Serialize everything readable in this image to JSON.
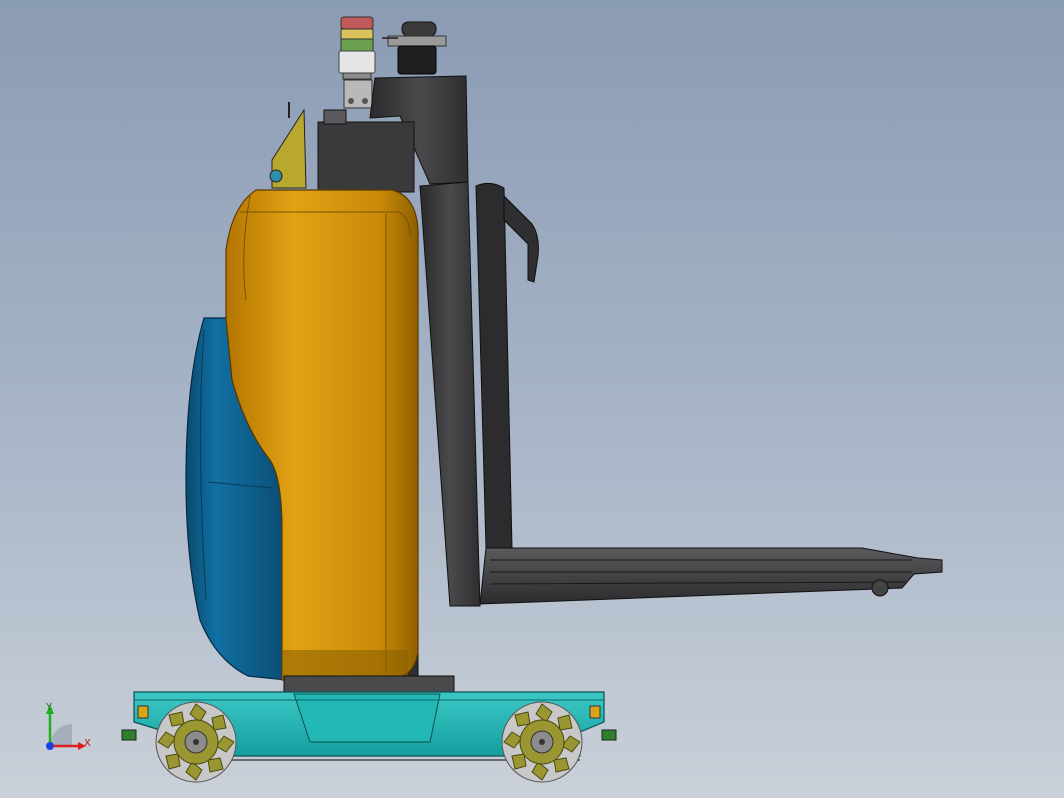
{
  "viewport": {
    "background_top": "#8a9bb4",
    "background_bottom": "#c9d0d8"
  },
  "model": {
    "colors": {
      "cover_orange": "#d99a12",
      "cover_blue": "#0d5c86",
      "chassis_teal": "#1fb3b3",
      "mast_dark": "#3c3c3e",
      "wheel_olive": "#9a9632",
      "panel_olive": "#b4a72e"
    }
  },
  "triad": {
    "x_label": "X",
    "y_label": "Y",
    "x_color": "#e02020",
    "y_color": "#20b020",
    "z_color": "#2040e0"
  }
}
